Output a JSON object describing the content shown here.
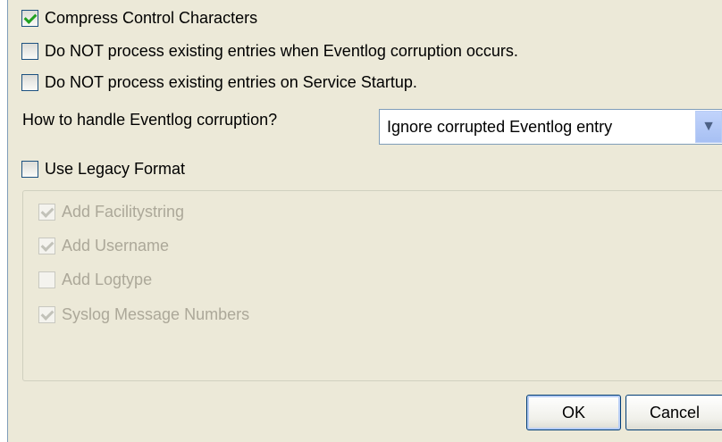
{
  "options": {
    "compress_control": {
      "label": "Compress Control Characters",
      "checked": true
    },
    "no_process_corruption": {
      "label": "Do NOT process existing entries when Eventlog corruption occurs.",
      "checked": false
    },
    "no_process_startup": {
      "label": "Do NOT process existing entries on Service Startup.",
      "checked": false
    },
    "use_legacy": {
      "label": "Use Legacy Format",
      "checked": false
    }
  },
  "corruption": {
    "question": "How to handle Eventlog corruption?",
    "selected": "Ignore corrupted Eventlog entry"
  },
  "legacy_group": {
    "add_facility": {
      "label": "Add Facilitystring",
      "checked": true
    },
    "add_username": {
      "label": "Add Username",
      "checked": true
    },
    "add_logtype": {
      "label": "Add Logtype",
      "checked": false
    },
    "syslog_numbers": {
      "label": "Syslog Message Numbers",
      "checked": true
    }
  },
  "buttons": {
    "ok": "OK",
    "cancel": "Cancel"
  },
  "icons": {
    "dropdown": "chevron-down-icon",
    "check": "checkmark-icon"
  },
  "colors": {
    "background": "#ece9d8",
    "check": "#21a121",
    "disabled_text": "#aca899"
  }
}
